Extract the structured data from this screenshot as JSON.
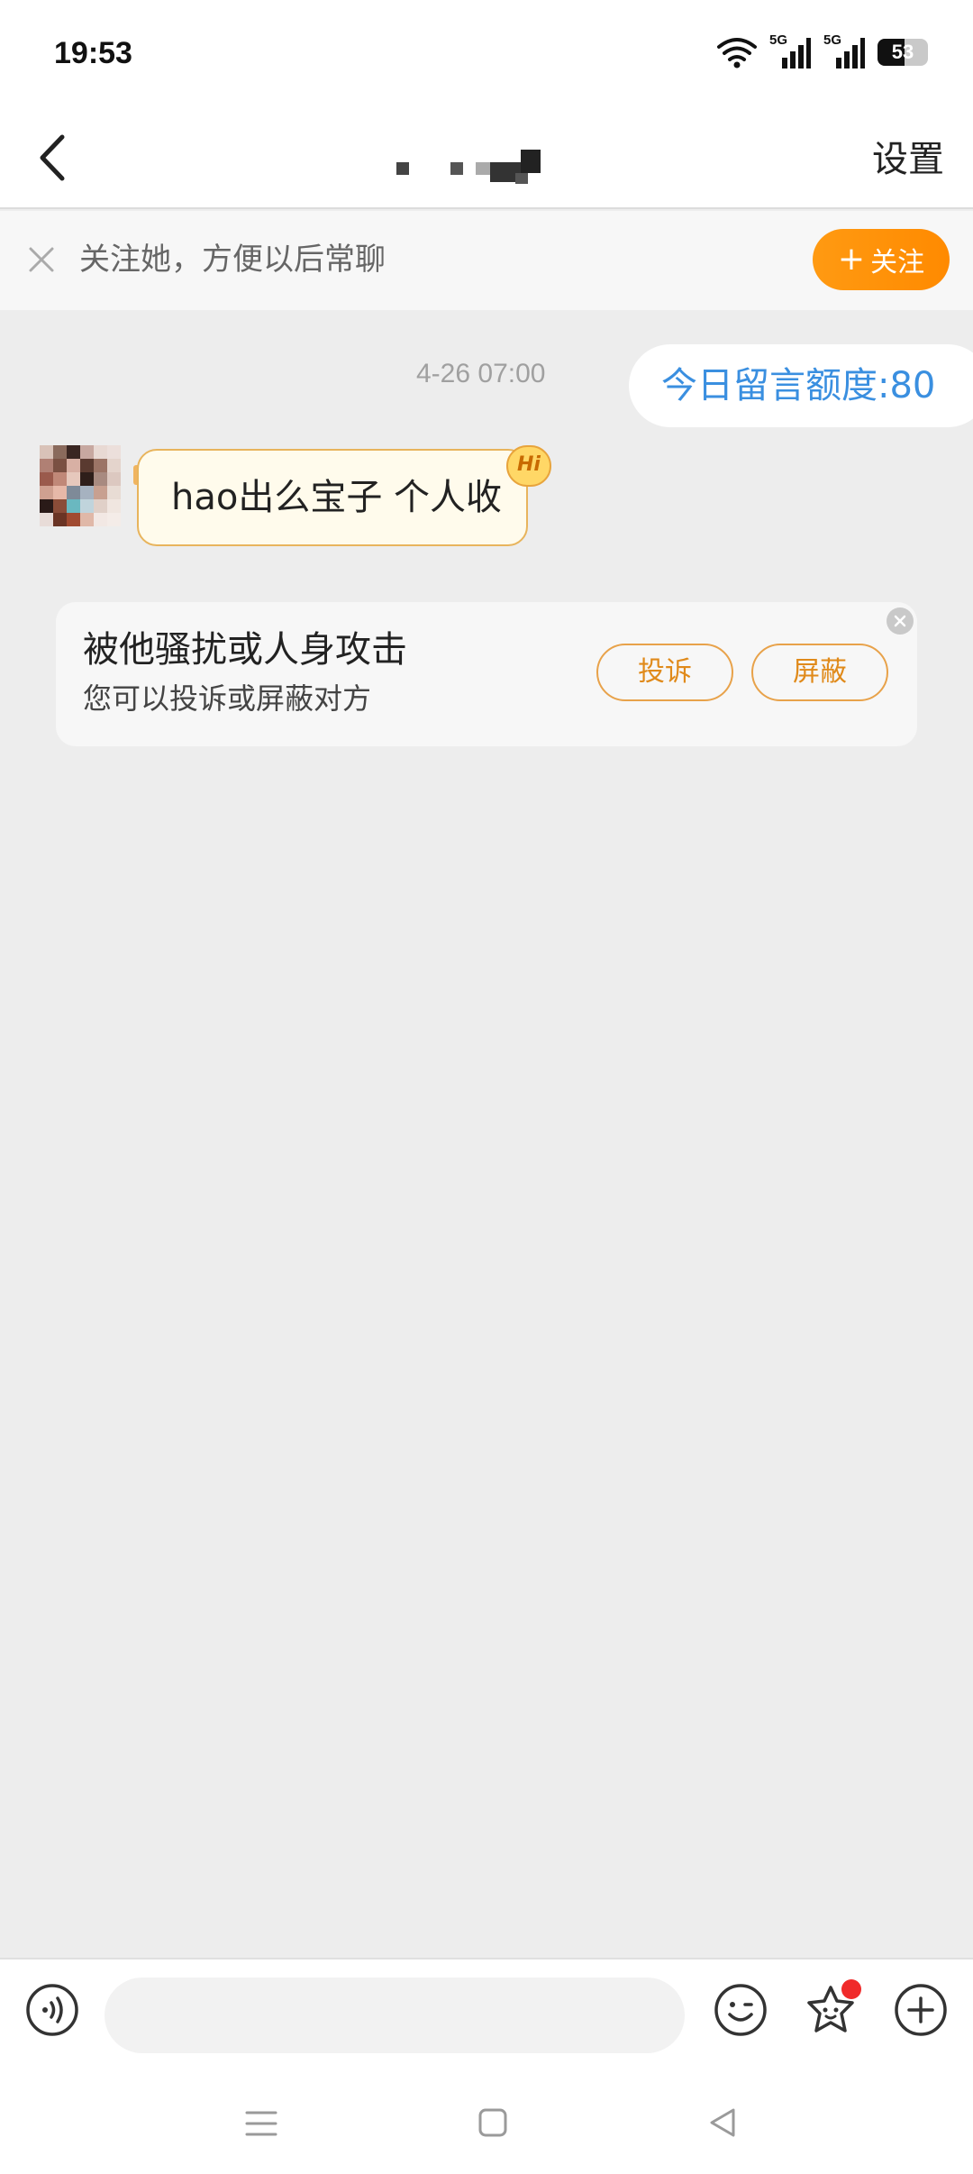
{
  "status_bar": {
    "time": "19:53",
    "network_labels": [
      "5G",
      "5G"
    ],
    "battery_level": "53",
    "battery_percent": 53
  },
  "header": {
    "back_icon": "chevron-left-icon",
    "title_redacted": true,
    "settings_label": "设置"
  },
  "follow_banner": {
    "close_icon": "close-icon",
    "text": "关注她，方便以后常聊",
    "button_plus": "+",
    "button_label": "关注",
    "button_color": "#ff8f00"
  },
  "chat": {
    "timestamp": "4-26 07:00",
    "quota_text": "今日留言额度:80",
    "quota_color": "#3a8fe0",
    "messages": [
      {
        "text": "hao出么宝子 个人收",
        "badge": "Hi"
      }
    ]
  },
  "report_card": {
    "title": "被他骚扰或人身攻击",
    "subtitle": "您可以投诉或屏蔽对方",
    "report_label": "投诉",
    "block_label": "屏蔽",
    "accent_color": "#e08a1a"
  },
  "input_bar": {
    "input_value": "",
    "icons": [
      "voice-icon",
      "emoji-icon",
      "sticker-icon",
      "plus-circle-icon"
    ],
    "notification_dot": true
  },
  "nav_bar": {
    "icons": [
      "menu-icon",
      "home-square-icon",
      "back-triangle-icon"
    ]
  }
}
